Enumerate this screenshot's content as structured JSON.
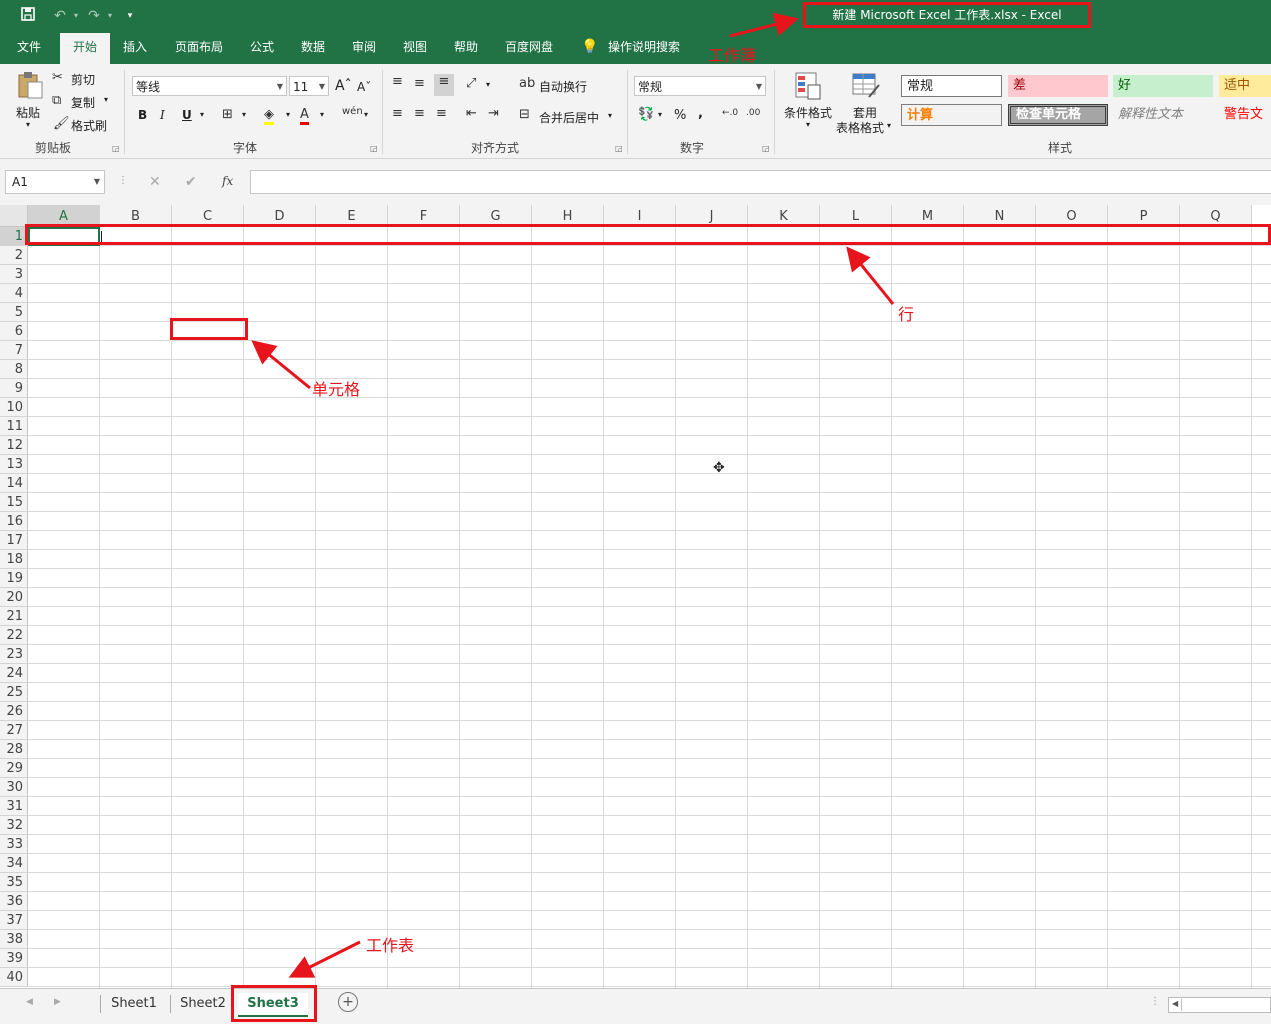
{
  "title_bar": {
    "title": "新建 Microsoft Excel 工作表.xlsx  -  Excel"
  },
  "tabs": [
    "文件",
    "开始",
    "插入",
    "页面布局",
    "公式",
    "数据",
    "审阅",
    "视图",
    "帮助",
    "百度网盘",
    "操作说明搜索"
  ],
  "clipboard": {
    "paste": "粘贴",
    "cut": "剪切",
    "copy": "复制",
    "format_painter": "格式刷",
    "label": "剪贴板"
  },
  "font": {
    "name": "等线",
    "size": "11",
    "label": "字体",
    "bold": "B",
    "italic": "I",
    "underline": "U"
  },
  "alignment": {
    "wrap": "自动换行",
    "merge": "合并后居中",
    "label": "对齐方式"
  },
  "number": {
    "format": "常规",
    "percent": "%",
    "comma": ",",
    "label": "数字"
  },
  "styles": {
    "conditional": "条件格式",
    "table_line1": "套用",
    "table_line2": "表格格式",
    "label": "样式",
    "cells": [
      "常规",
      "差",
      "好",
      "适中",
      "计算",
      "检查单元格",
      "解释性文本",
      "警告文"
    ]
  },
  "formula_bar": {
    "name_box": "A1",
    "fx": "fx"
  },
  "columns": [
    "A",
    "B",
    "C",
    "D",
    "E",
    "F",
    "G",
    "H",
    "I",
    "J",
    "K",
    "L",
    "M",
    "N",
    "O",
    "P",
    "Q"
  ],
  "rows": [
    "1",
    "2",
    "3",
    "4",
    "5",
    "6",
    "7",
    "8",
    "9",
    "10",
    "11",
    "12",
    "13",
    "14",
    "15",
    "16",
    "17",
    "18",
    "19",
    "20",
    "21",
    "22",
    "23",
    "24",
    "25",
    "26",
    "27",
    "28",
    "29",
    "30",
    "31",
    "32",
    "33",
    "34",
    "35",
    "36",
    "37",
    "38",
    "39",
    "40"
  ],
  "sheets": [
    "Sheet1",
    "Sheet2",
    "Sheet3"
  ],
  "active_sheet": "Sheet3",
  "annotations": {
    "workbook": "工作簿",
    "row": "行",
    "cell": "单元格",
    "worksheet": "工作表"
  },
  "colors": {
    "excel_green": "#217346",
    "annotation_red": "#e8141c"
  }
}
